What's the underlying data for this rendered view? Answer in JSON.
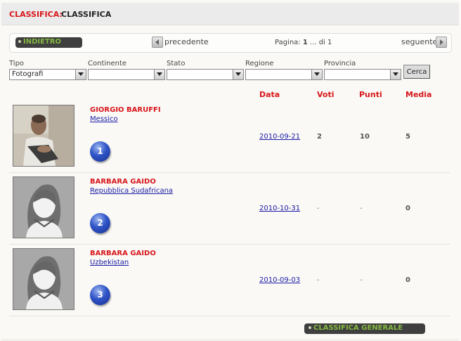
{
  "header": {
    "label": "CLASSIFICA:",
    "title": "CLASSIFICA"
  },
  "pager": {
    "back_label": "INDIETRO",
    "prev_label": "precedente",
    "page_prefix": "Pagina:",
    "page_current": "1",
    "page_sep": "... di",
    "page_total": "1",
    "next_label": "seguente"
  },
  "filters": {
    "tipo": {
      "label": "Tipo",
      "value": "Fotografi"
    },
    "continente": {
      "label": "Continente",
      "value": ""
    },
    "stato": {
      "label": "Stato",
      "value": ""
    },
    "regione": {
      "label": "Regione",
      "value": ""
    },
    "provincia": {
      "label": "Provincia",
      "value": ""
    },
    "search_label": "Cerca"
  },
  "columns": {
    "data": "Data",
    "voti": "Voti",
    "punti": "Punti",
    "media": "Media"
  },
  "rows": [
    {
      "name": "GIORGIO BARUFFI",
      "country": "Messico",
      "rank": "1",
      "date": "2010-09-21",
      "voti": "2",
      "punti": "10",
      "media": "5",
      "photo": "user-photo"
    },
    {
      "name": "BARBARA GAIDO",
      "country": "Repubblica Sudafricana",
      "rank": "2",
      "date": "2010-10-31",
      "voti": "-",
      "punti": "-",
      "media": "0",
      "photo": "female-avatar-placeholder"
    },
    {
      "name": "BARBARA GAIDO",
      "country": "Uzbekistan",
      "rank": "3",
      "date": "2010-09-03",
      "voti": "-",
      "punti": "-",
      "media": "0",
      "photo": "female-avatar-placeholder"
    }
  ],
  "footer": {
    "general_label": "CLASSIFICA GENERALE"
  },
  "colors": {
    "accent_red": "#d8161b",
    "link_blue": "#1a1aa6",
    "button_dark": "#3f3f3f",
    "button_text_green": "#84b841"
  }
}
